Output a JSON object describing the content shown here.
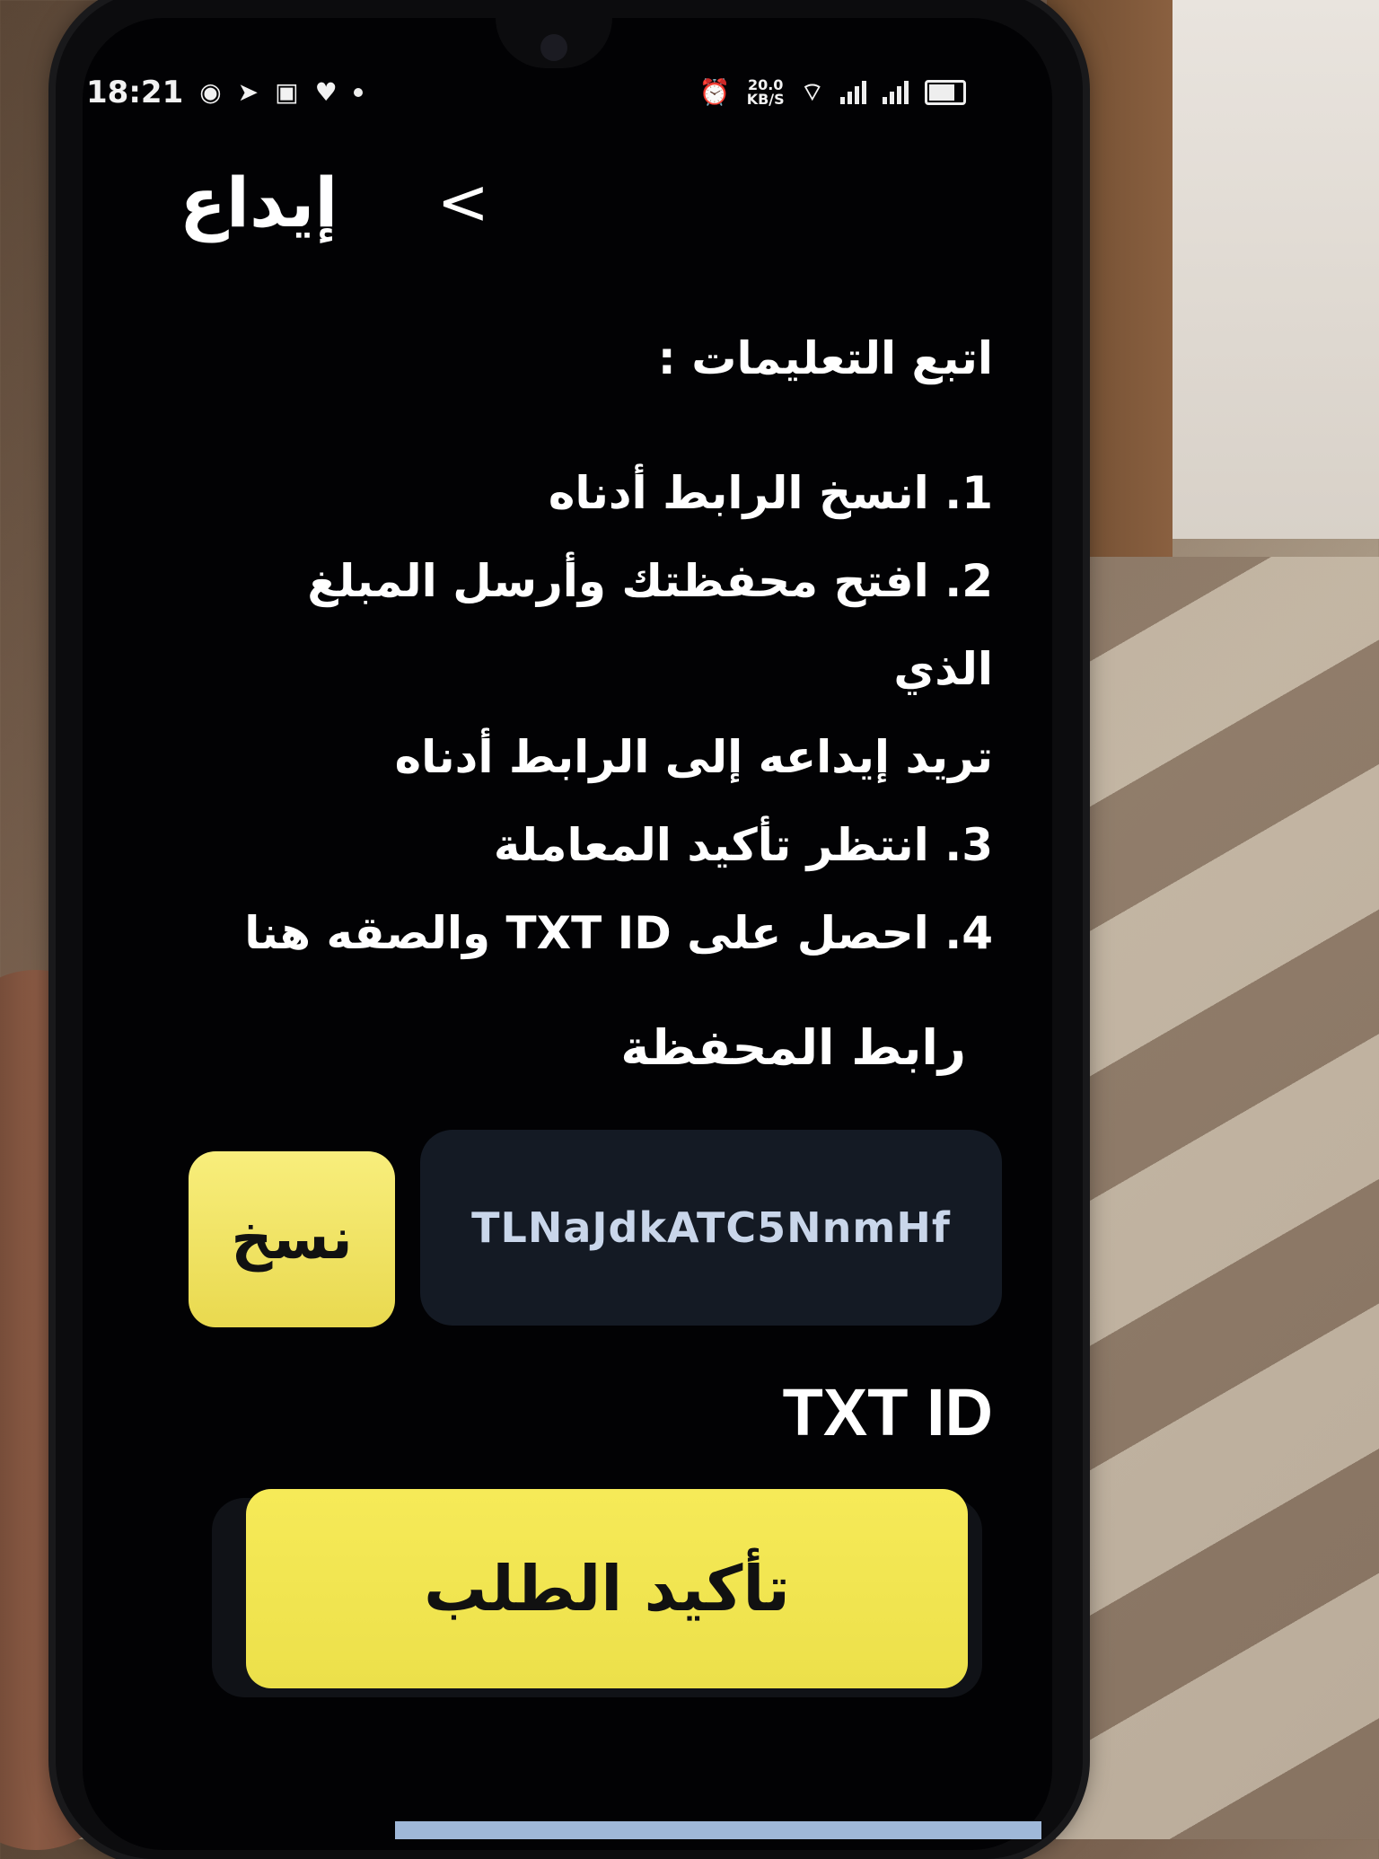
{
  "status_bar": {
    "time": "18:21",
    "left_icons": [
      "messenger-icon",
      "telegram-icon",
      "message-icon",
      "heart-icon",
      "dot-icon"
    ],
    "right_icons": [
      "alarm-icon",
      "wifi-icon",
      "signal-icon",
      "signal-icon",
      "battery-icon"
    ],
    "speed_value": "20.0",
    "speed_unit": "KB/S"
  },
  "header": {
    "title": "إيداع",
    "back_icon": "chevron-right-icon"
  },
  "instructions": {
    "title": "اتبع التعليمات :",
    "steps": [
      "1. انسخ الرابط أدناه",
      "2. افتح محفظتك وأرسل المبلغ الذي",
      "تريد إيداعه إلى الرابط أدناه",
      "3. انتظر تأكيد المعاملة",
      "4. احصل على TXT ID والصقه هنا"
    ]
  },
  "wallet": {
    "label": "رابط المحفظة",
    "address": "TLNaJdkATC5NnmHf",
    "copy_label": "نسخ"
  },
  "txid": {
    "label": "TXT ID",
    "value": ""
  },
  "confirm_button": {
    "label": "تأكيد الطلب"
  },
  "colors": {
    "screen_bg": "#020204",
    "accent_yellow": "#f2e55a",
    "address_field_bg": "#141a24",
    "address_text": "#c9d6ea",
    "text": "#ffffff"
  }
}
